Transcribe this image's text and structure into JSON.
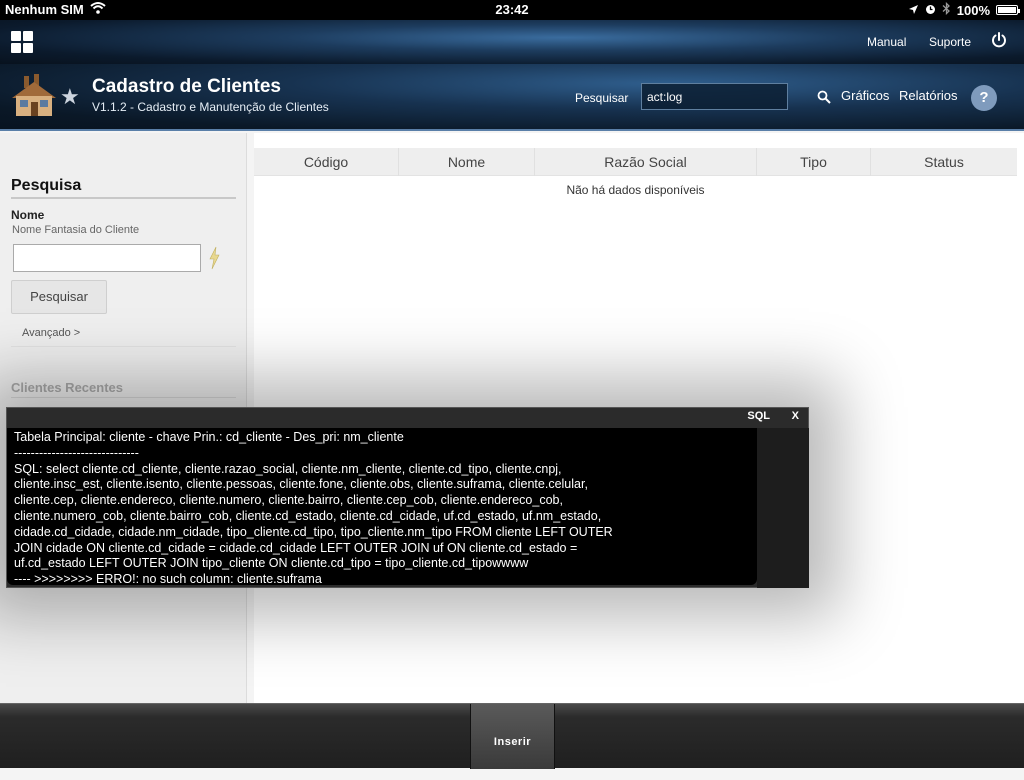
{
  "statusbar": {
    "carrier": "Nenhum SIM",
    "time": "23:42",
    "battery": "100%"
  },
  "topnav": {
    "manual": "Manual",
    "suporte": "Suporte"
  },
  "header": {
    "title": "Cadastro de Clientes",
    "subtitle": "V1.1.2 - Cadastro e Manutenção de Clientes",
    "search_label": "Pesquisar",
    "search_value": "act:log",
    "graficos": "Gráficos",
    "relatorios": "Relatórios",
    "help": "?"
  },
  "sidebar": {
    "heading": "Pesquisa",
    "nome_label": "Nome",
    "nome_hint": "Nome Fantasia do Cliente",
    "pesquisar_button": "Pesquisar",
    "avancado_link": "Avançado >",
    "recentes_heading": "Clientes Recentes"
  },
  "table": {
    "columns": [
      "Código",
      "Nome",
      "Razão Social",
      "Tipo",
      "Status"
    ],
    "empty_message": "Não há dados disponíveis"
  },
  "sql_panel": {
    "title": "SQL",
    "close": "X",
    "lines": [
      "Tabela Principal: cliente - chave Prin.: cd_cliente - Des_pri: nm_cliente",
      "------------------------------",
      "SQL: select cliente.cd_cliente, cliente.razao_social, cliente.nm_cliente, cliente.cd_tipo, cliente.cnpj,",
      "cliente.insc_est, cliente.isento, cliente.pessoas, cliente.fone, cliente.obs, cliente.suframa, cliente.celular,",
      "cliente.cep, cliente.endereco, cliente.numero, cliente.bairro, cliente.cep_cob, cliente.endereco_cob,",
      "cliente.numero_cob, cliente.bairro_cob, cliente.cd_estado, cliente.cd_cidade, uf.cd_estado, uf.nm_estado,",
      "cidade.cd_cidade, cidade.nm_cidade, tipo_cliente.cd_tipo, tipo_cliente.nm_tipo FROM cliente LEFT OUTER",
      "JOIN cidade ON cliente.cd_cidade = cidade.cd_cidade LEFT OUTER JOIN uf ON cliente.cd_estado =",
      "uf.cd_estado LEFT OUTER JOIN tipo_cliente ON cliente.cd_tipo = tipo_cliente.cd_tipowwww",
      "---- >>>>>>>> ERRO!: no such column: cliente.suframa"
    ]
  },
  "bottombar": {
    "inserir": "Inserir"
  }
}
